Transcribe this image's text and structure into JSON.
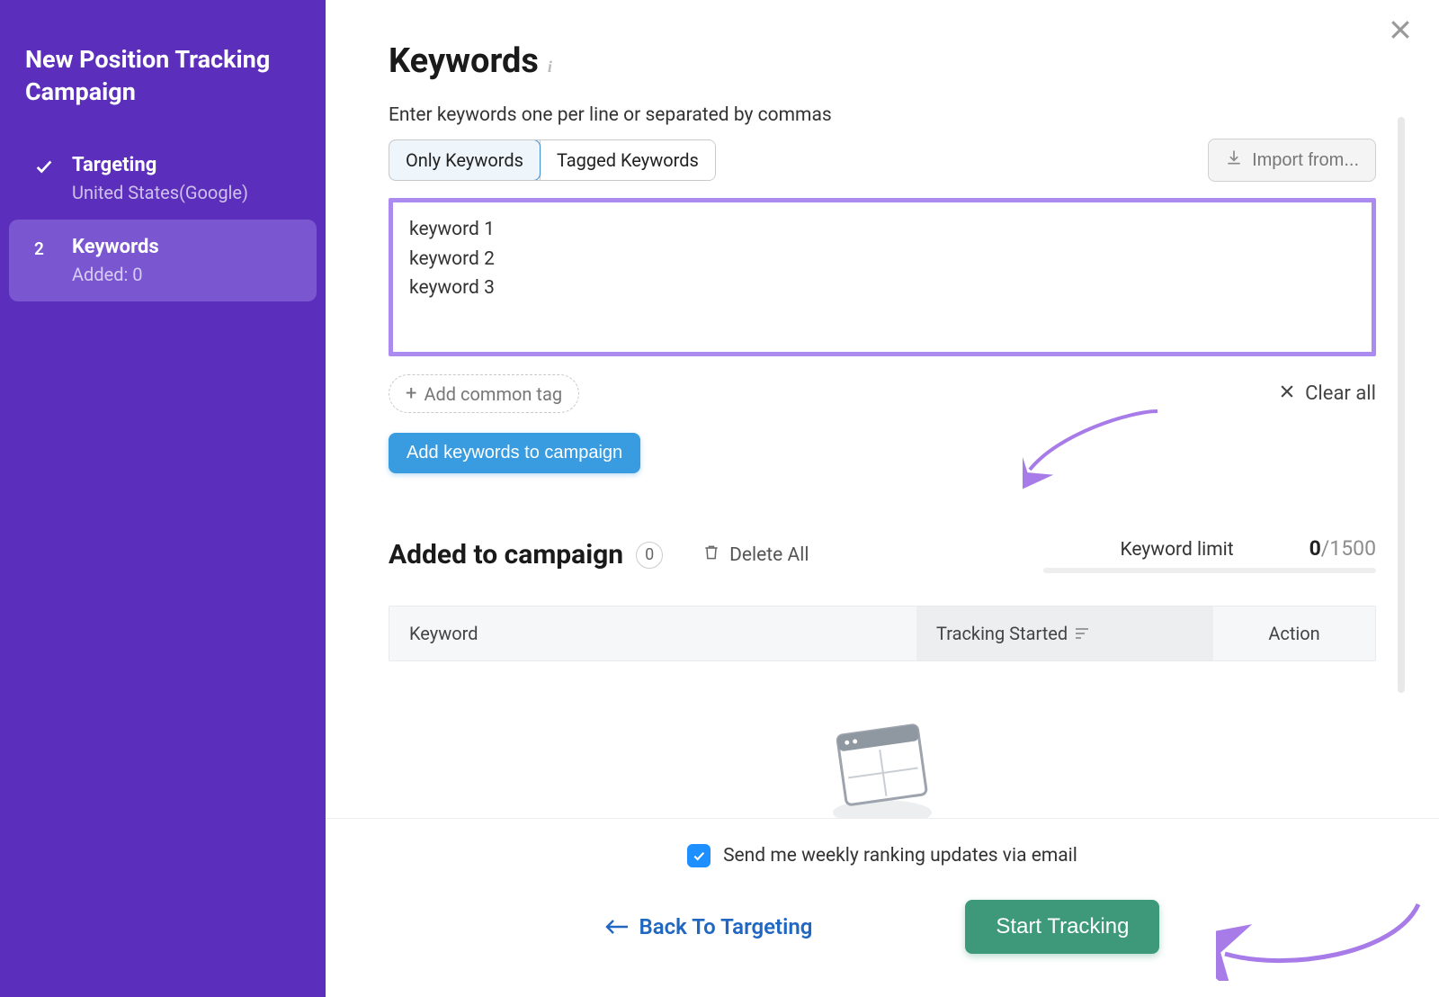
{
  "sidebar": {
    "title": "New Position Tracking Campaign",
    "steps": [
      {
        "label": "Targeting",
        "sub": "United States(Google)",
        "indicator": "check"
      },
      {
        "label": "Keywords",
        "sub": "Added: 0",
        "indicator": "2"
      }
    ]
  },
  "header": {
    "title": "Keywords"
  },
  "input": {
    "hint": "Enter keywords one per line or separated by commas",
    "tabs": {
      "only": "Only Keywords",
      "tagged": "Tagged Keywords"
    },
    "import_label": "Import from...",
    "lines": [
      "keyword 1",
      "keyword 2",
      "keyword 3"
    ],
    "add_tag_label": "Add common tag",
    "clear_all_label": "Clear all",
    "add_btn_label": "Add keywords to campaign"
  },
  "campaign": {
    "title": "Added to campaign",
    "count": "0",
    "delete_all_label": "Delete All",
    "limit_label": "Keyword limit",
    "limit_used": "0",
    "limit_total": "/1500",
    "columns": {
      "keyword": "Keyword",
      "tracking": "Tracking Started",
      "action": "Action"
    }
  },
  "footer": {
    "email_label": "Send me weekly ranking updates via email",
    "back_label": "Back To Targeting",
    "start_label": "Start Tracking"
  }
}
